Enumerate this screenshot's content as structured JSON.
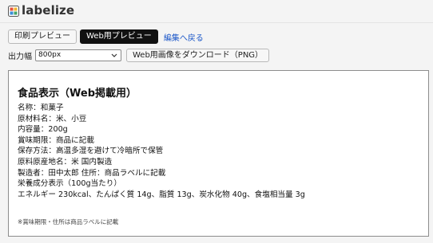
{
  "app": {
    "name": "labelize"
  },
  "toolbar": {
    "print_preview_label": "印刷プレビュー",
    "web_preview_label": "Web用プレビュー",
    "back_to_edit_label": "編集へ戻る",
    "output_width_label": "出力幅",
    "output_width_value": "800px",
    "download_label": "Web用画像をダウンロード（PNG）"
  },
  "label": {
    "title": "食品表示（Web掲載用）",
    "lines": [
      "名称：和菓子",
      "原材料名：米、小豆",
      "内容量：200g",
      "賞味期限：商品に記載",
      "保存方法：高温多湿を避けて冷暗所で保管",
      "原料原産地名：米 国内製造",
      "製造者：田中太郎 住所：商品ラベルに記載",
      "栄養成分表示（100g当たり）",
      "エネルギー 230kcal、たんぱく質 14g、脂質 13g、炭水化物 40g、食塩相当量 3g"
    ],
    "note": "※賞味期限・住所は商品ラベルに記載"
  },
  "icons": {
    "logo": "labelize-logo-icon",
    "select_arrow": "chevron-down-icon"
  },
  "colors": {
    "primary_button": "#111111",
    "link": "#1a56c8",
    "background": "#f4f4f4"
  }
}
